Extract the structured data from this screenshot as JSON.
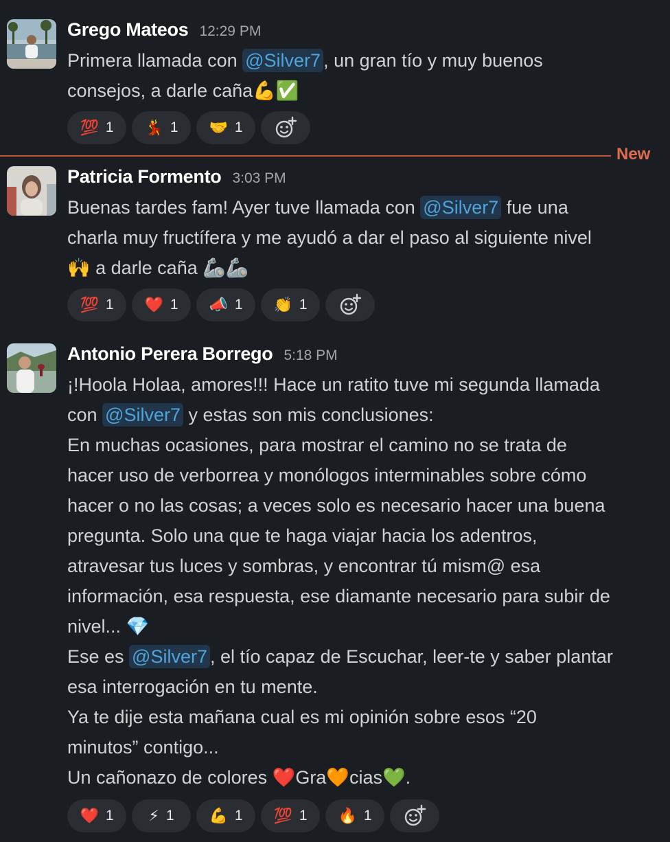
{
  "colors": {
    "background": "#1a1d21",
    "mention_bg": "#21364a",
    "mention_text": "#4ea3d9",
    "new_divider": "#c0533a",
    "reaction_bg": "#2a2d31"
  },
  "divider": {
    "label": "New"
  },
  "messages": [
    {
      "name": "Grego Mateos",
      "time": "12:29 PM",
      "lines": [
        [
          {
            "t": "text",
            "v": "Primera llamada con "
          },
          {
            "t": "mention",
            "v": "@Silver7"
          },
          {
            "t": "text",
            "v": ", un gran tío y muy buenos"
          }
        ],
        [
          {
            "t": "text",
            "v": "consejos, a darle caña"
          },
          {
            "t": "emoji",
            "v": "💪"
          },
          {
            "t": "emoji",
            "v": "✅"
          }
        ]
      ],
      "reactions": [
        {
          "emoji": "💯",
          "count": "1",
          "icon": "hundred-points-icon"
        },
        {
          "emoji": "💃",
          "count": "1",
          "icon": "dancer-icon"
        },
        {
          "emoji": "🤝",
          "count": "1",
          "icon": "handshake-icon"
        }
      ]
    },
    {
      "name": "Patricia Formento",
      "time": "3:03 PM",
      "lines": [
        [
          {
            "t": "text",
            "v": "Buenas tardes fam! Ayer tuve llamada con "
          },
          {
            "t": "mention",
            "v": "@Silver7"
          },
          {
            "t": "text",
            "v": " fue una"
          }
        ],
        [
          {
            "t": "text",
            "v": "charla muy fructífera y me ayudó a dar el paso al siguiente nivel"
          }
        ],
        [
          {
            "t": "emoji",
            "v": "🙌"
          },
          {
            "t": "text",
            "v": "  a darle caña "
          },
          {
            "t": "emoji",
            "v": "🦾"
          },
          {
            "t": "emoji",
            "v": "🦾"
          }
        ]
      ],
      "reactions": [
        {
          "emoji": "💯",
          "count": "1",
          "icon": "hundred-points-icon"
        },
        {
          "emoji": "❤️",
          "count": "1",
          "icon": "heart-icon"
        },
        {
          "emoji": "📣",
          "count": "1",
          "icon": "megaphone-icon"
        },
        {
          "emoji": "👏",
          "count": "1",
          "icon": "clapping-hands-icon"
        }
      ]
    },
    {
      "name": "Antonio Perera Borrego",
      "time": "5:18 PM",
      "lines": [
        [
          {
            "t": "text",
            "v": "¡!Hoola Holaa, amores!!! Hace un ratito tuve mi segunda llamada"
          }
        ],
        [
          {
            "t": "text",
            "v": "con "
          },
          {
            "t": "mention",
            "v": "@Silver7"
          },
          {
            "t": "text",
            "v": " y estas son mis conclusiones:"
          }
        ],
        [
          {
            "t": "text",
            "v": "En muchas ocasiones, para mostrar el camino no se trata de"
          }
        ],
        [
          {
            "t": "text",
            "v": "hacer uso de verborrea y monólogos interminables sobre cómo"
          }
        ],
        [
          {
            "t": "text",
            "v": "hacer o no las cosas; a veces solo es necesario hacer una buena"
          }
        ],
        [
          {
            "t": "text",
            "v": "pregunta. Solo una que te haga viajar hacia los adentros,"
          }
        ],
        [
          {
            "t": "text",
            "v": "atravesar tus luces y sombras, y encontrar tú mism@ esa"
          }
        ],
        [
          {
            "t": "text",
            "v": "información, esa respuesta, ese diamante necesario para subir de"
          }
        ],
        [
          {
            "t": "text",
            "v": "nivel... "
          },
          {
            "t": "emoji",
            "v": "💎"
          }
        ],
        [
          {
            "t": "text",
            "v": "Ese es "
          },
          {
            "t": "mention",
            "v": "@Silver7"
          },
          {
            "t": "text",
            "v": ", el tío capaz de Escuchar, leer-te y saber plantar"
          }
        ],
        [
          {
            "t": "text",
            "v": "esa interrogación en tu mente."
          }
        ],
        [
          {
            "t": "text",
            "v": "Ya te dije esta mañana cual es mi opinión sobre esos “20"
          }
        ],
        [
          {
            "t": "text",
            "v": "minutos” contigo..."
          }
        ],
        [
          {
            "t": "text",
            "v": "Un cañonazo de colores "
          },
          {
            "t": "emoji",
            "v": "❤️"
          },
          {
            "t": "text",
            "v": "Gra"
          },
          {
            "t": "emoji",
            "v": "🧡"
          },
          {
            "t": "text",
            "v": "cias"
          },
          {
            "t": "emoji",
            "v": "💚"
          },
          {
            "t": "text",
            "v": "."
          }
        ]
      ],
      "reactions": [
        {
          "emoji": "❤️",
          "count": "1",
          "icon": "heart-icon"
        },
        {
          "emoji": "⚡",
          "count": "1",
          "icon": "lightning-icon"
        },
        {
          "emoji": "💪",
          "count": "1",
          "icon": "flexed-biceps-icon"
        },
        {
          "emoji": "💯",
          "count": "1",
          "icon": "hundred-points-icon"
        },
        {
          "emoji": "🔥",
          "count": "1",
          "icon": "fire-icon"
        }
      ]
    }
  ]
}
